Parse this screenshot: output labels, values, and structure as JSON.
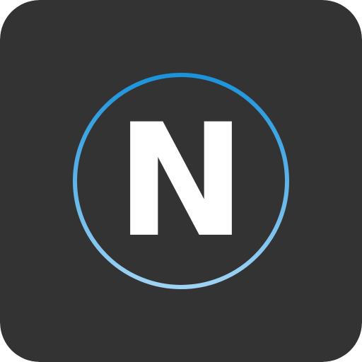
{
  "icon": {
    "logo_name": "n-logo-icon",
    "letter": "N",
    "colors": {
      "background": "#333333",
      "letter": "#ffffff",
      "ring_top": "#1a93dc",
      "ring_bottom": "#9fd3f4"
    }
  }
}
